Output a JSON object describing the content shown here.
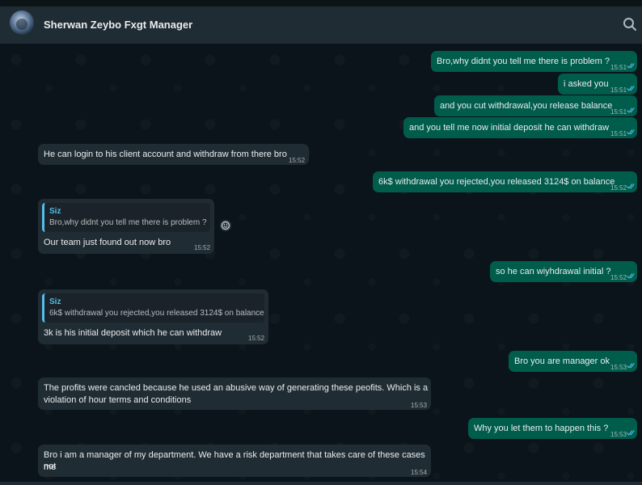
{
  "header": {
    "contact_name": "Sherwan Zeybo Fxgt Manager"
  },
  "icons": {
    "search": "search-icon",
    "read_receipt": "double-check-icon",
    "reaction": "emoji-icon"
  },
  "colors": {
    "outgoing_bubble": "#005c4b",
    "incoming_bubble": "#202c33",
    "quote_accent": "#53bdeb",
    "read_ticks": "#53bdeb",
    "chat_background": "#0b141a"
  },
  "messages": [
    {
      "direction": "out",
      "text": "Bro,why didnt you tell me there is problem ?",
      "time": "15:51",
      "read": true
    },
    {
      "direction": "out",
      "text": "i asked you",
      "time": "15:51",
      "read": true
    },
    {
      "direction": "out",
      "text": "and you cut withdrawal,you release balance",
      "time": "15:51",
      "read": true
    },
    {
      "direction": "out",
      "text": "and you tell me now initial deposit he can withdraw",
      "time": "15:51",
      "read": true
    },
    {
      "direction": "in",
      "text": "He can login to his client account and withdraw from there bro",
      "time": "15:52"
    },
    {
      "direction": "out",
      "text": "6k$ withdrawal you rejected,you released 3124$ on balance",
      "time": "15:52",
      "read": true
    },
    {
      "direction": "in",
      "quote": {
        "author": "Siz",
        "text": "Bro,why didnt you tell me there is problem ?"
      },
      "text": "Our team just found out now bro",
      "time": "15:52"
    },
    {
      "direction": "out",
      "text": "so he can wiyhdrawal initial ?",
      "time": "15:52",
      "read": true
    },
    {
      "direction": "in",
      "quote": {
        "author": "Siz",
        "text": "6k$ withdrawal you rejected,you released 3124$ on balance"
      },
      "text": "3k is his initial deposit which he can withdraw",
      "time": "15:52"
    },
    {
      "direction": "out",
      "text": "Bro you are manager ok",
      "time": "15:53",
      "read": true
    },
    {
      "direction": "in",
      "text_lines": [
        "The profits were cancled because he used an abusive way of generating these peofits. Which is a",
        "violation of hour terms and conditions"
      ],
      "time": "15:53"
    },
    {
      "direction": "out",
      "text": "Why you let them to happen this ?",
      "time": "15:53",
      "read": true
    },
    {
      "direction": "in",
      "text_lines": [
        "Bro i am a manager of my department. We have a risk department that takes care of these cases not",
        "me"
      ],
      "time": "15:54"
    }
  ]
}
